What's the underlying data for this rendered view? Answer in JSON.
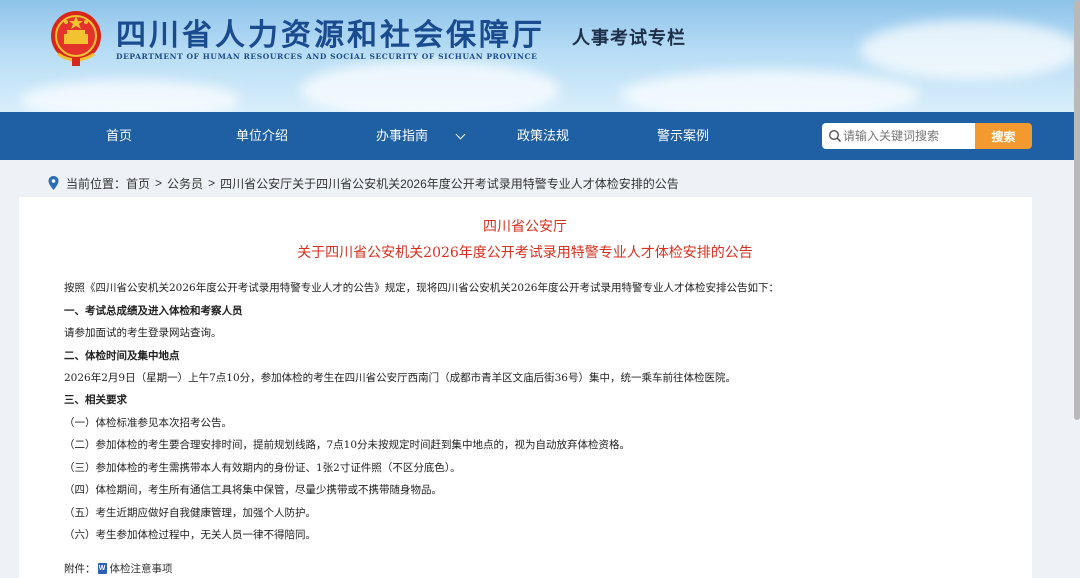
{
  "header": {
    "site_title": "四川省人力资源和社会保障厅",
    "site_subtitle": "DEPARTMENT OF HUMAN RESOURCES AND SOCIAL SECURITY OF SICHUAN PROVINCE",
    "column_tag": "人事考试专栏",
    "emblem_icon": "national-emblem-icon"
  },
  "nav": {
    "items": [
      {
        "label": "首页"
      },
      {
        "label": "单位介绍"
      },
      {
        "label": "办事指南"
      },
      {
        "label": "政策法规"
      },
      {
        "label": "警示案例"
      }
    ],
    "search_placeholder": "请输入关键词搜索",
    "search_button": "搜索"
  },
  "breadcrumb": {
    "prefix": "当前位置：",
    "items": [
      "首页",
      "公务员",
      "四川省公安厅关于四川省公安机关2026年度公开考试录用特警专业人才体检安排的公告"
    ],
    "separator": ">"
  },
  "article": {
    "org": "四川省公安厅",
    "title": "关于四川省公安机关2026年度公开考试录用特警专业人才体检安排的公告",
    "paragraphs": [
      "按照《四川省公安机关2026年度公开考试录用特警专业人才的公告》规定，现将四川省公安机关2026年度公开考试录用特警专业人才体检安排公告如下：",
      "一、考试总成绩及进入体检和考察人员",
      "请参加面试的考生登录网站查询。",
      "二、体检时间及集中地点",
      "2026年2月9日（星期一）上午7点10分，参加体检的考生在四川省公安厅西南门（成都市青羊区文庙后街36号）集中，统一乘车前往体检医院。",
      "三、相关要求",
      "（一）体检标准参见本次招考公告。",
      "（二）参加体检的考生要合理安排时间，提前规划线路，7点10分未按规定时间赶到集中地点的，视为自动放弃体检资格。",
      "（三）参加体检的考生需携带本人有效期内的身份证、1张2寸证件照（不区分底色）。",
      "（四）体检期间，考生所有通信工具将集中保管，尽量少携带或不携带随身物品。",
      "（五）考生近期应做好自我健康管理，加强个人防护。",
      "（六）考生参加体检过程中，无关人员一律不得陪同。"
    ],
    "attachment_label": "附件：",
    "attachment_name": "体检注意事项"
  },
  "colors": {
    "nav_bg": "#1f5fa3",
    "title_red": "#d6301f",
    "search_orange": "#f39a2e",
    "brand_blue": "#1b4b8f"
  }
}
